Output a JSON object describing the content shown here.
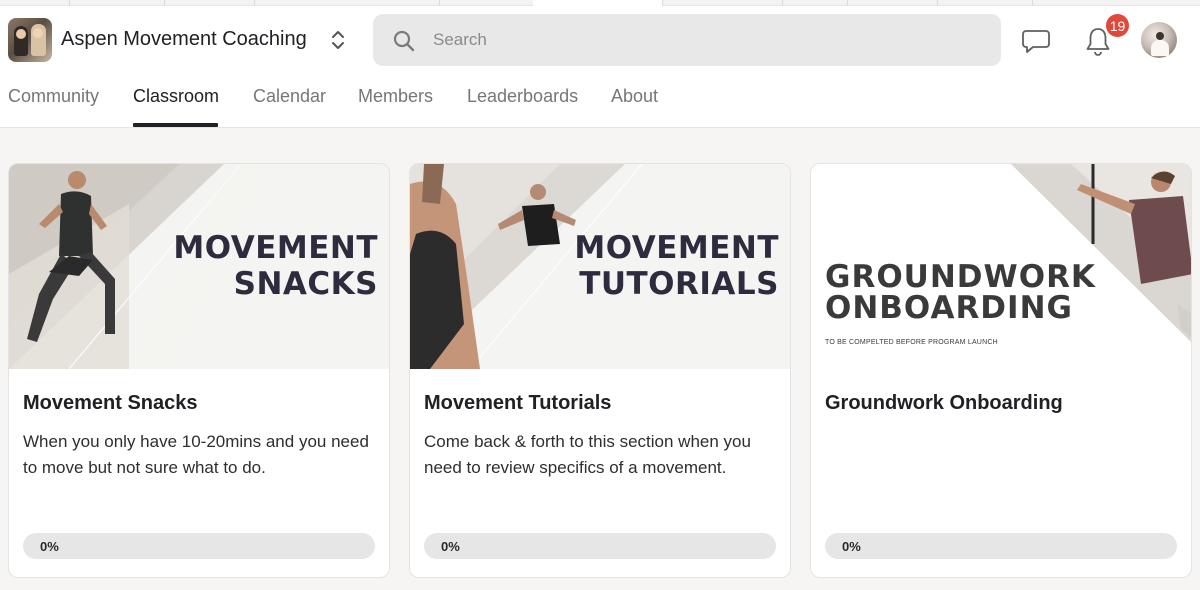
{
  "header": {
    "group_name": "Aspen Movement Coaching",
    "search_placeholder": "Search",
    "notification_count": "19"
  },
  "nav": {
    "tabs": [
      {
        "label": "Community",
        "active": false
      },
      {
        "label": "Classroom",
        "active": true
      },
      {
        "label": "Calendar",
        "active": false
      },
      {
        "label": "Members",
        "active": false
      },
      {
        "label": "Leaderboards",
        "active": false
      },
      {
        "label": "About",
        "active": false
      }
    ]
  },
  "courses": [
    {
      "banner_line1": "MOVEMENT",
      "banner_line2": "SNACKS",
      "title": "Movement Snacks",
      "description": "When you only have 10-20mins and you need to move but not sure what to do.",
      "progress": 0,
      "progress_label": "0%"
    },
    {
      "banner_line1": "MOVEMENT",
      "banner_line2": "TUTORIALS",
      "title": "Movement Tutorials",
      "description": "Come back & forth to this section when you need to review specifics of a movement.",
      "progress": 0,
      "progress_label": "0%"
    },
    {
      "banner_line1": "GROUNDWORK",
      "banner_line2": "ONBOARDING",
      "banner_subtext": "TO BE COMPELTED BEFORE PROGRAM LAUNCH",
      "title": "Groundwork Onboarding",
      "description": "",
      "progress": 0,
      "progress_label": "0%"
    }
  ],
  "colors": {
    "badge": "#e0493a",
    "active_tab": "#202124",
    "inactive_tab": "#767676",
    "banner_text": "#2e2b3e"
  }
}
